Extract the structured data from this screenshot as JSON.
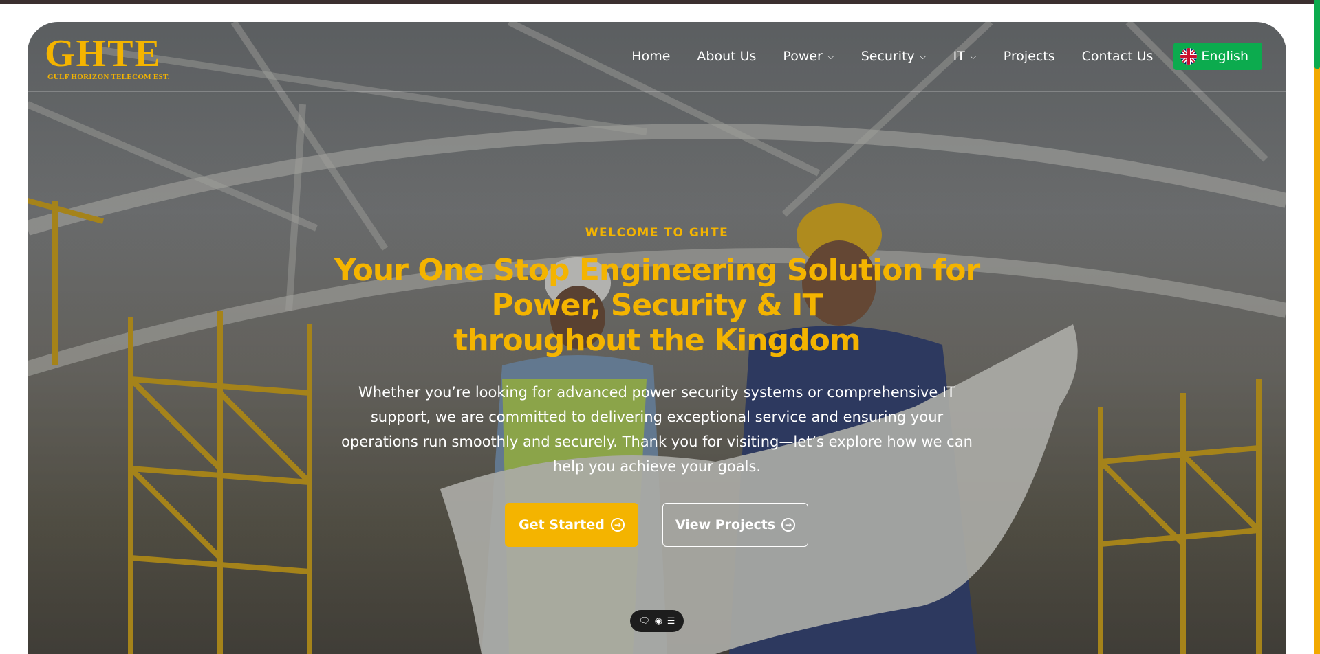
{
  "logo": {
    "main": "GHTE",
    "sub": "GULF HORIZON TELECOM EST."
  },
  "nav": {
    "items": [
      {
        "label": "Home",
        "has_dropdown": false
      },
      {
        "label": "About Us",
        "has_dropdown": false
      },
      {
        "label": "Power",
        "has_dropdown": true
      },
      {
        "label": "Security",
        "has_dropdown": true
      },
      {
        "label": "IT",
        "has_dropdown": true
      },
      {
        "label": "Projects",
        "has_dropdown": false
      },
      {
        "label": "Contact Us",
        "has_dropdown": false
      }
    ],
    "language": {
      "label": "English",
      "flag": "uk-flag-icon"
    }
  },
  "hero": {
    "eyebrow": "WELCOME TO GHTE",
    "headline": {
      "line1": "Your One Stop Engineering Solution for",
      "line2": "Power, Security & IT",
      "line3": "throughout the Kingdom"
    },
    "description": "Whether you’re looking for advanced power security systems or comprehensive IT support, we are committed to delivering exceptional service and ensuring your operations run smoothly and securely. Thank you for visiting—let’s explore how we can help you achieve your goals.",
    "primary_button": "Get Started",
    "secondary_button": "View Projects"
  },
  "widget": {
    "icons": [
      "chat-icon",
      "eye-icon",
      "settings-sliders-icon"
    ]
  },
  "colors": {
    "accent": "#f4b400",
    "language_button": "#0cab4e",
    "widget_bg": "#1d1d1d",
    "topbar": "#3b2f2f"
  }
}
